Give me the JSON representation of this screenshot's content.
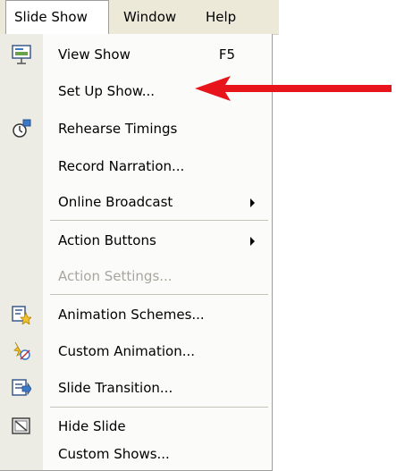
{
  "menubar": {
    "slide_show": "Slide Show",
    "window": "Window",
    "help": "Help"
  },
  "menu": {
    "view_show": {
      "label": "View Show",
      "shortcut": "F5"
    },
    "set_up_show": "Set Up Show...",
    "rehearse_timings": "Rehearse Timings",
    "record_narration": "Record Narration...",
    "online_broadcast": "Online Broadcast",
    "action_buttons": "Action Buttons",
    "action_settings": "Action Settings...",
    "animation_schemes": "Animation Schemes...",
    "custom_animation": "Custom Animation...",
    "slide_transition": "Slide Transition...",
    "hide_slide": "Hide Slide",
    "custom_shows": "Custom Shows..."
  },
  "colors": {
    "annotation_arrow": "#e8141b",
    "menu_bar": "#ece9d8",
    "icon_gutter": "#ecebe4",
    "disabled_text": "#a8a69c"
  },
  "icons": [
    "projector-screen-icon",
    "stopwatch-icon",
    "animation-schemes-icon",
    "custom-animation-icon",
    "slide-transition-icon",
    "hide-slide-icon"
  ]
}
